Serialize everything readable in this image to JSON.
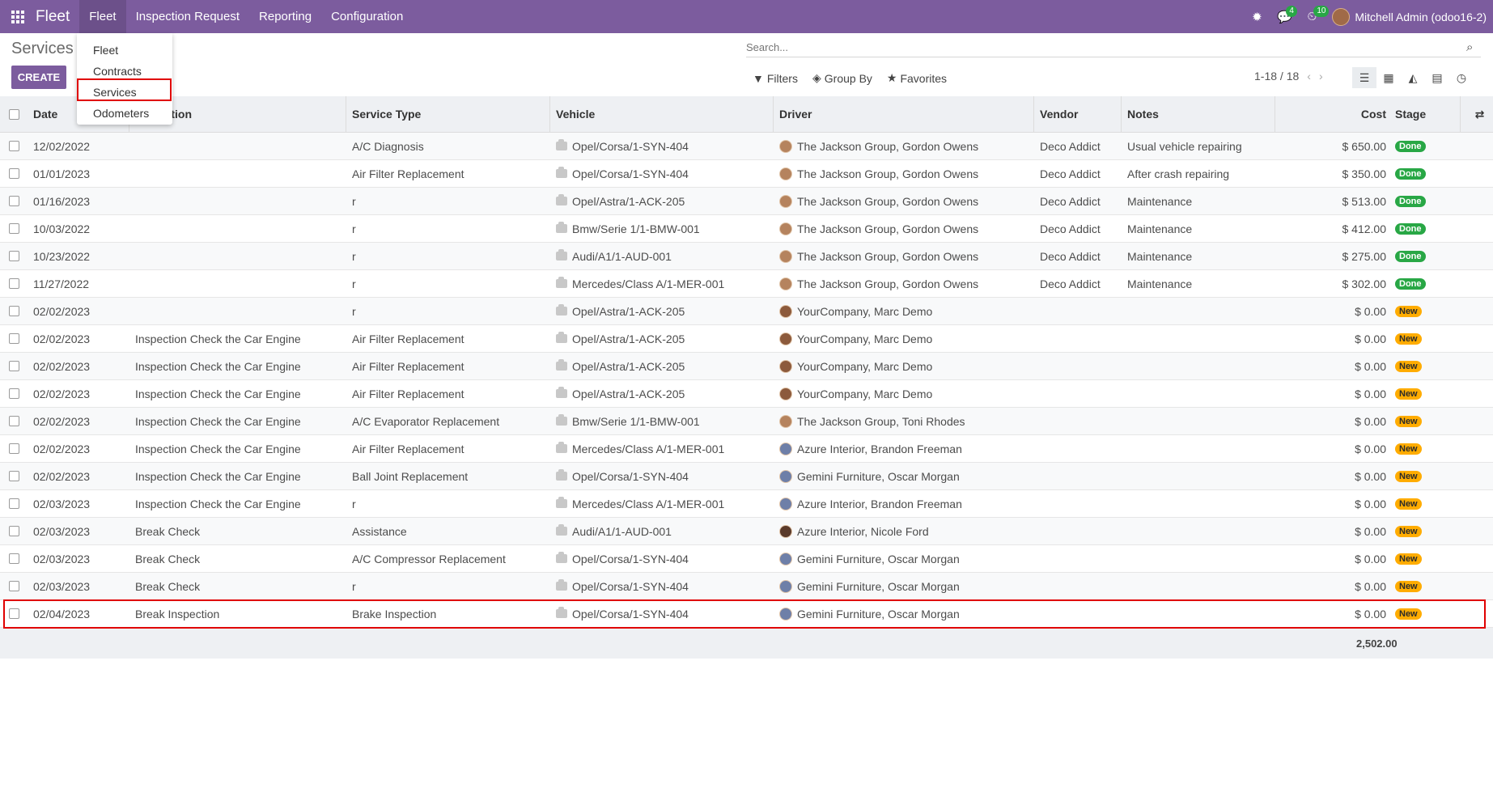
{
  "navbar": {
    "brand": "Fleet",
    "menus": [
      "Fleet",
      "Inspection Request",
      "Reporting",
      "Configuration"
    ],
    "chat_count": "4",
    "activity_count": "10",
    "user": "Mitchell Admin (odoo16-2)"
  },
  "dropdown": {
    "items": [
      "Fleet",
      "Contracts",
      "Services",
      "Odometers"
    ]
  },
  "control_panel": {
    "breadcrumb": "Services",
    "create_label": "CREATE",
    "search_placeholder": "Search...",
    "filters_label": "Filters",
    "group_by_label": "Group By",
    "favorites_label": "Favorites",
    "pager": "1-18 / 18"
  },
  "table": {
    "headers": {
      "date": "Date",
      "inspection": "Inspection",
      "service_type": "Service Type",
      "vehicle": "Vehicle",
      "driver": "Driver",
      "vendor": "Vendor",
      "notes": "Notes",
      "cost": "Cost",
      "stage": "Stage"
    },
    "rows": [
      {
        "date": "12/02/2022",
        "inspection": "",
        "service_type": "A/C Diagnosis",
        "vehicle": "Opel/Corsa/1-SYN-404",
        "driver": "The Jackson Group, Gordon Owens",
        "vendor": "Deco Addict",
        "notes": "Usual vehicle repairing",
        "cost": "$ 650.00",
        "stage": "Done"
      },
      {
        "date": "01/01/2023",
        "inspection": "",
        "service_type": "Air Filter Replacement",
        "vehicle": "Opel/Corsa/1-SYN-404",
        "driver": "The Jackson Group, Gordon Owens",
        "vendor": "Deco Addict",
        "notes": "After crash repairing",
        "cost": "$ 350.00",
        "stage": "Done"
      },
      {
        "date": "01/16/2023",
        "inspection": "",
        "service_type": "r",
        "vehicle": "Opel/Astra/1-ACK-205",
        "driver": "The Jackson Group, Gordon Owens",
        "vendor": "Deco Addict",
        "notes": "Maintenance",
        "cost": "$ 513.00",
        "stage": "Done"
      },
      {
        "date": "10/03/2022",
        "inspection": "",
        "service_type": "r",
        "vehicle": "Bmw/Serie 1/1-BMW-001",
        "driver": "The Jackson Group, Gordon Owens",
        "vendor": "Deco Addict",
        "notes": "Maintenance",
        "cost": "$ 412.00",
        "stage": "Done"
      },
      {
        "date": "10/23/2022",
        "inspection": "",
        "service_type": "r",
        "vehicle": "Audi/A1/1-AUD-001",
        "driver": "The Jackson Group, Gordon Owens",
        "vendor": "Deco Addict",
        "notes": "Maintenance",
        "cost": "$ 275.00",
        "stage": "Done"
      },
      {
        "date": "11/27/2022",
        "inspection": "",
        "service_type": "r",
        "vehicle": "Mercedes/Class A/1-MER-001",
        "driver": "The Jackson Group, Gordon Owens",
        "vendor": "Deco Addict",
        "notes": "Maintenance",
        "cost": "$ 302.00",
        "stage": "Done"
      },
      {
        "date": "02/02/2023",
        "inspection": "",
        "service_type": "r",
        "vehicle": "Opel/Astra/1-ACK-205",
        "driver": "YourCompany, Marc Demo",
        "vendor": "",
        "notes": "",
        "cost": "$ 0.00",
        "stage": "New"
      },
      {
        "date": "02/02/2023",
        "inspection": "Inspection Check the Car Engine",
        "service_type": "Air Filter Replacement",
        "vehicle": "Opel/Astra/1-ACK-205",
        "driver": "YourCompany, Marc Demo",
        "vendor": "",
        "notes": "",
        "cost": "$ 0.00",
        "stage": "New"
      },
      {
        "date": "02/02/2023",
        "inspection": "Inspection Check the Car Engine",
        "service_type": "Air Filter Replacement",
        "vehicle": "Opel/Astra/1-ACK-205",
        "driver": "YourCompany, Marc Demo",
        "vendor": "",
        "notes": "",
        "cost": "$ 0.00",
        "stage": "New"
      },
      {
        "date": "02/02/2023",
        "inspection": "Inspection Check the Car Engine",
        "service_type": "Air Filter Replacement",
        "vehicle": "Opel/Astra/1-ACK-205",
        "driver": "YourCompany, Marc Demo",
        "vendor": "",
        "notes": "",
        "cost": "$ 0.00",
        "stage": "New"
      },
      {
        "date": "02/02/2023",
        "inspection": "Inspection Check the Car Engine",
        "service_type": "A/C Evaporator Replacement",
        "vehicle": "Bmw/Serie 1/1-BMW-001",
        "driver": "The Jackson Group, Toni Rhodes",
        "vendor": "",
        "notes": "",
        "cost": "$ 0.00",
        "stage": "New"
      },
      {
        "date": "02/02/2023",
        "inspection": "Inspection Check the Car Engine",
        "service_type": "Air Filter Replacement",
        "vehicle": "Mercedes/Class A/1-MER-001",
        "driver": "Azure Interior, Brandon Freeman",
        "vendor": "",
        "notes": "",
        "cost": "$ 0.00",
        "stage": "New"
      },
      {
        "date": "02/02/2023",
        "inspection": "Inspection Check the Car Engine",
        "service_type": "Ball Joint Replacement",
        "vehicle": "Opel/Corsa/1-SYN-404",
        "driver": "Gemini Furniture, Oscar Morgan",
        "vendor": "",
        "notes": "",
        "cost": "$ 0.00",
        "stage": "New"
      },
      {
        "date": "02/03/2023",
        "inspection": "Inspection Check the Car Engine",
        "service_type": "r",
        "vehicle": "Mercedes/Class A/1-MER-001",
        "driver": "Azure Interior, Brandon Freeman",
        "vendor": "",
        "notes": "",
        "cost": "$ 0.00",
        "stage": "New"
      },
      {
        "date": "02/03/2023",
        "inspection": "Break Check",
        "service_type": "Assistance",
        "vehicle": "Audi/A1/1-AUD-001",
        "driver": "Azure Interior, Nicole Ford",
        "vendor": "",
        "notes": "",
        "cost": "$ 0.00",
        "stage": "New"
      },
      {
        "date": "02/03/2023",
        "inspection": "Break Check",
        "service_type": "A/C Compressor Replacement",
        "vehicle": "Opel/Corsa/1-SYN-404",
        "driver": "Gemini Furniture, Oscar Morgan",
        "vendor": "",
        "notes": "",
        "cost": "$ 0.00",
        "stage": "New"
      },
      {
        "date": "02/03/2023",
        "inspection": "Break Check",
        "service_type": "r",
        "vehicle": "Opel/Corsa/1-SYN-404",
        "driver": "Gemini Furniture, Oscar Morgan",
        "vendor": "",
        "notes": "",
        "cost": "$ 0.00",
        "stage": "New"
      },
      {
        "date": "02/04/2023",
        "inspection": "Break Inspection",
        "service_type": "Brake Inspection",
        "vehicle": "Opel/Corsa/1-SYN-404",
        "driver": "Gemini Furniture, Oscar Morgan",
        "vendor": "",
        "notes": "",
        "cost": "$ 0.00",
        "stage": "New"
      }
    ],
    "total_cost": "2,502.00"
  },
  "colors": {
    "brand": "#7c5c9e",
    "done": "#28a745",
    "new": "#ffac00",
    "highlight": "#e00000"
  }
}
